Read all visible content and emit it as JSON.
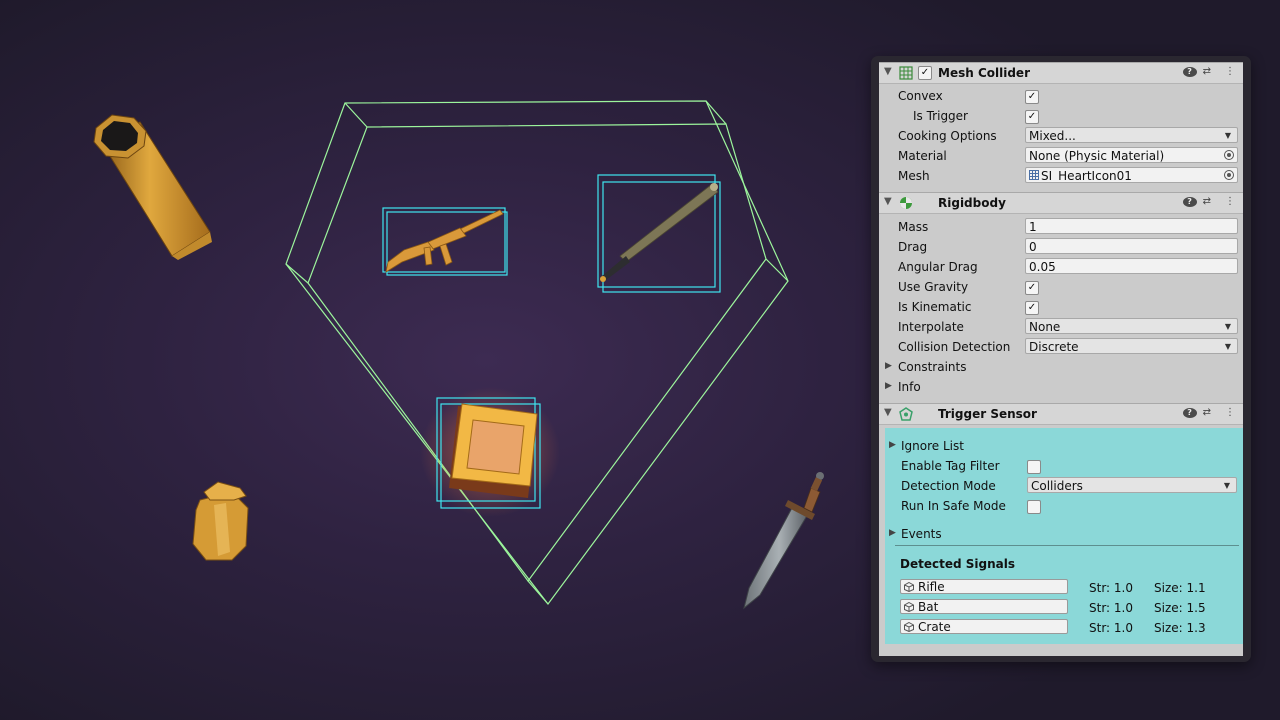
{
  "mesh_collider": {
    "title": "Mesh Collider",
    "enabled_mark": "✓",
    "convex_label": "Convex",
    "convex_mark": "✓",
    "is_trigger_label": "Is Trigger",
    "is_trigger_mark": "✓",
    "cooking_label": "Cooking Options",
    "cooking_value": "Mixed...",
    "material_label": "Material",
    "material_value": "None (Physic Material)",
    "mesh_label": "Mesh",
    "mesh_value": "SI_HeartIcon01"
  },
  "rigidbody": {
    "title": "Rigidbody",
    "mass_label": "Mass",
    "mass_value": "1",
    "drag_label": "Drag",
    "drag_value": "0",
    "angular_drag_label": "Angular Drag",
    "angular_drag_value": "0.05",
    "use_gravity_label": "Use Gravity",
    "use_gravity_mark": "✓",
    "is_kinematic_label": "Is Kinematic",
    "is_kinematic_mark": "✓",
    "interpolate_label": "Interpolate",
    "interpolate_value": "None",
    "collision_label": "Collision Detection",
    "collision_value": "Discrete",
    "constraints_label": "Constraints",
    "info_label": "Info"
  },
  "trigger_sensor": {
    "title": "Trigger Sensor",
    "ignore_list_label": "Ignore List",
    "enable_tag_filter_label": "Enable Tag Filter",
    "enable_tag_filter_mark": "",
    "detection_mode_label": "Detection Mode",
    "detection_mode_value": "Colliders",
    "run_safe_label": "Run In Safe Mode",
    "run_safe_mark": "",
    "events_label": "Events",
    "signals_title": "Detected Signals",
    "signals": [
      {
        "name": "Rifle",
        "str": "Str: 1.0",
        "size": "Size: 1.1"
      },
      {
        "name": "Bat",
        "str": "Str: 1.0",
        "size": "Size: 1.5"
      },
      {
        "name": "Crate",
        "str": "Str: 1.0",
        "size": "Size: 1.3"
      }
    ]
  },
  "colors": {
    "gizmo_trigger": "#9cf59c",
    "gizmo_bounds": "#3fe6f0",
    "sensor_panel": "#8bd8d8",
    "prop_gold": "#d9a23a"
  }
}
